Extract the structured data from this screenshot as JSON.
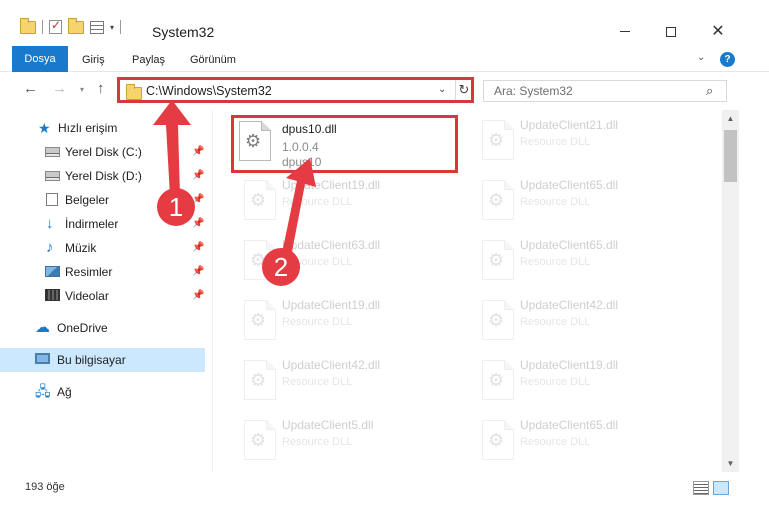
{
  "window": {
    "title": "System32",
    "quick_access_dropdown": "▾",
    "minimize_label": "",
    "close_glyph": "✕"
  },
  "ribbon": {
    "tabs": [
      "Dosya",
      "Giriş",
      "Paylaş",
      "Görünüm"
    ],
    "collapse_glyph": "⌄",
    "help_glyph": "?"
  },
  "address": {
    "path": "C:\\Windows\\System32",
    "search_placeholder": "Ara: System32"
  },
  "sidebar": {
    "items": [
      {
        "label": "Hızlı erişim",
        "icon": "star-icon",
        "pinned": false
      },
      {
        "label": "Yerel Disk (C:)",
        "icon": "disk-icon",
        "pinned": true
      },
      {
        "label": "Yerel Disk (D:)",
        "icon": "disk-icon",
        "pinned": true
      },
      {
        "label": "Belgeler",
        "icon": "document-icon",
        "pinned": true
      },
      {
        "label": "İndirmeler",
        "icon": "download-icon",
        "pinned": true
      },
      {
        "label": "Müzik",
        "icon": "music-icon",
        "pinned": true
      },
      {
        "label": "Resimler",
        "icon": "pictures-icon",
        "pinned": true
      },
      {
        "label": "Videolar",
        "icon": "video-icon",
        "pinned": true
      },
      {
        "label": "OneDrive",
        "icon": "cloud-icon",
        "pinned": false
      },
      {
        "label": "Bu bilgisayar",
        "icon": "computer-icon",
        "pinned": false,
        "selected": true
      },
      {
        "label": "Ağ",
        "icon": "network-icon",
        "pinned": false
      }
    ]
  },
  "files": {
    "highlighted": {
      "name": "dpus10.dll",
      "version": "1.0.0.4",
      "description": "dpus10"
    },
    "left_column": [
      {
        "name": "UpdateClient19.dll",
        "type": "Resource DLL"
      },
      {
        "name": "UpdateClient63.dll",
        "type": "Resource DLL"
      },
      {
        "name": "UpdateClient19.dll",
        "type": "Resource DLL"
      },
      {
        "name": "UpdateClient42.dll",
        "type": "Resource DLL"
      },
      {
        "name": "UpdateClient5.dll",
        "type": "Resource DLL"
      }
    ],
    "right_column": [
      {
        "name": "UpdateClient21.dll",
        "type": "Resource DLL"
      },
      {
        "name": "UpdateClient65.dll",
        "type": "Resource DLL"
      },
      {
        "name": "UpdateClient65.dll",
        "type": "Resource DLL"
      },
      {
        "name": "UpdateClient42.dll",
        "type": "Resource DLL"
      },
      {
        "name": "UpdateClient19.dll",
        "type": "Resource DLL"
      },
      {
        "name": "UpdateClient65.dll",
        "type": "Resource DLL"
      }
    ]
  },
  "status": {
    "item_count": "193 öğe"
  },
  "callouts": [
    "1",
    "2"
  ],
  "colors": {
    "accent": "#1979ca",
    "highlight_border": "#d9373b",
    "callout": "#e53b42",
    "selected_bg": "#cce8ff"
  }
}
